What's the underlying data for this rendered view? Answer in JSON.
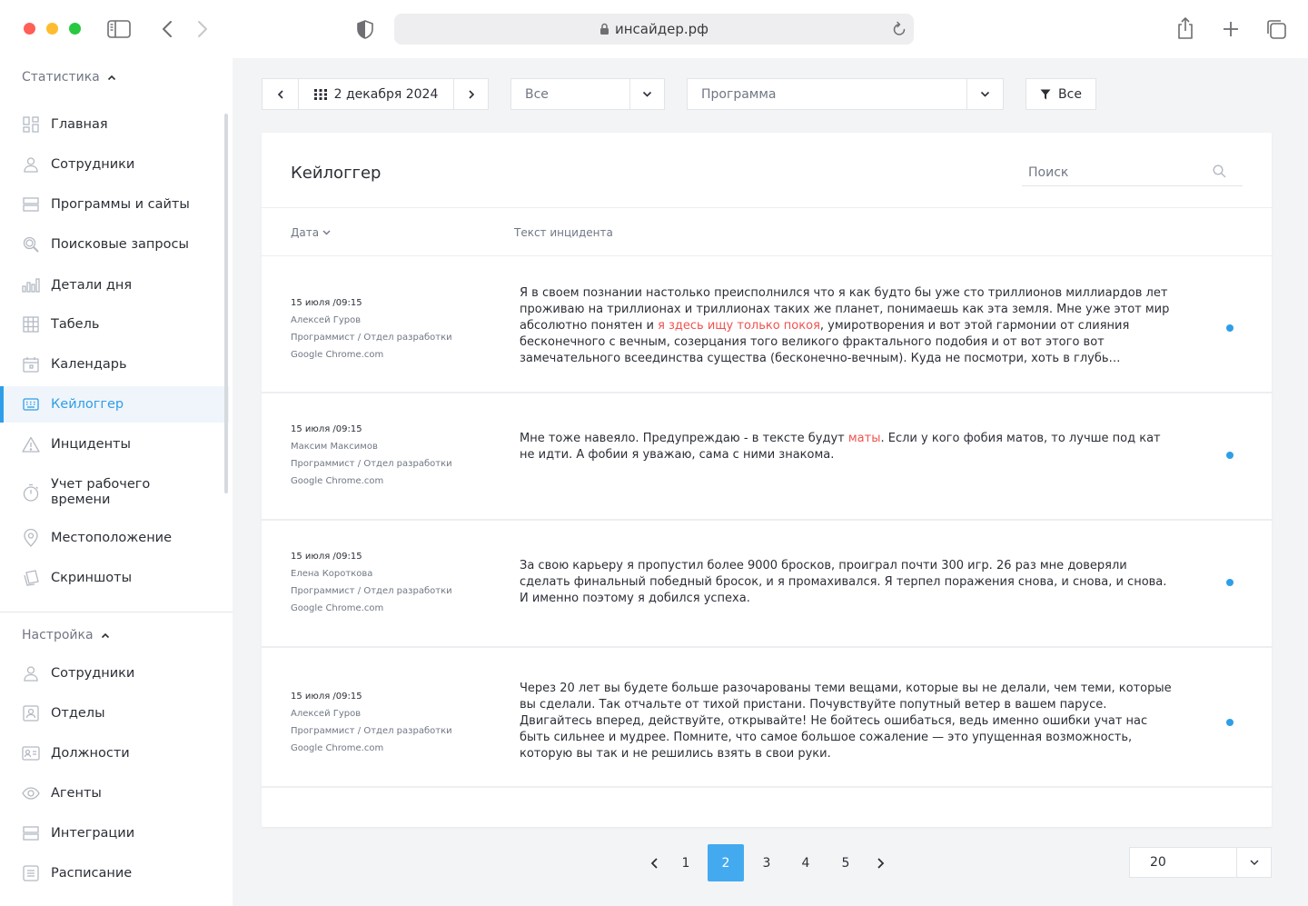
{
  "browser": {
    "url": "инсайдер.рф",
    "traffic_lights": [
      "#ff5f57",
      "#febc2e",
      "#28c840"
    ]
  },
  "sidebar": {
    "stats_section": "Статистика",
    "stats_items": [
      {
        "label": "Главная",
        "icon": "dashboard-icon"
      },
      {
        "label": "Сотрудники",
        "icon": "user-icon"
      },
      {
        "label": "Программы и сайты",
        "icon": "server-icon"
      },
      {
        "label": "Поисковые запросы",
        "icon": "search-icon"
      },
      {
        "label": "Детали дня",
        "icon": "bar-chart-icon"
      },
      {
        "label": "Табель",
        "icon": "grid-table-icon"
      },
      {
        "label": "Календарь",
        "icon": "calendar-icon"
      },
      {
        "label": "Кейлоггер",
        "icon": "keyboard-icon",
        "active": true
      },
      {
        "label": "Инциденты",
        "icon": "warning-icon"
      },
      {
        "label": "Учет рабочего\nвремени",
        "icon": "stopwatch-icon"
      },
      {
        "label": "Местоположение",
        "icon": "location-pin-icon"
      },
      {
        "label": "Скриншоты",
        "icon": "screenshots-icon"
      }
    ],
    "settings_section": "Настройка",
    "settings_items": [
      {
        "label": "Сотрудники",
        "icon": "user-icon"
      },
      {
        "label": "Отделы",
        "icon": "departments-icon"
      },
      {
        "label": "Должности",
        "icon": "id-card-icon"
      },
      {
        "label": "Агенты",
        "icon": "eye-icon"
      },
      {
        "label": "Интеграции",
        "icon": "server-icon"
      },
      {
        "label": "Расписание",
        "icon": "list-icon"
      }
    ]
  },
  "filters": {
    "date": "2 декабря 2024",
    "scope": "Все",
    "program_placeholder": "Программа",
    "filter_label": "Все"
  },
  "card": {
    "title": "Кейлоггер",
    "search_placeholder": "Поиск",
    "col_date": "Дата",
    "col_text": "Текст инцидента"
  },
  "rows": [
    {
      "date": "15 июля /09:15",
      "name": "Алексей Гуров",
      "role": "Программист / Отдел разработки",
      "app": "Google Chrome.com",
      "text_before": "Я в своем познании настолько преисполнился что я как будто бы уже сто триллионов миллиардов лет проживаю на триллионах и триллионах таких же планет, понимаешь как эта земля. Мне уже этот мир абсолютно понятен и ",
      "highlight": "я здесь ищу только покоя",
      "text_after": ", умиротворения и вот этой гармонии от слияния бесконечного с вечным, созерцания того великого фрактального подобия и от вот этого вот замечательного всеединства существа (бесконечно-вечным). Куда не посмотри, хоть в глубь…"
    },
    {
      "date": "15 июля /09:15",
      "name": "Максим Максимов",
      "role": "Программист / Отдел разработки",
      "app": "Google Chrome.com",
      "text_before": "Мне тоже навеяло. Предупреждаю - в тексте будут ",
      "highlight": "маты",
      "text_after": ". Если у кого фобия матов, то лучше под кат не идти. А фобии я уважаю, сама с ними знакома."
    },
    {
      "date": "15 июля /09:15",
      "name": "Елена Короткова",
      "role": "Программист / Отдел разработки",
      "app": "Google Chrome.com",
      "text_before": "За свою карьеру я пропустил более 9000 бросков, проиграл почти 300 игр. 26 раз мне доверяли сделать финальный победный бросок, и я промахивался. Я терпел поражения снова, и снова, и снова. И именно поэтому я добился успеха.",
      "highlight": "",
      "text_after": ""
    },
    {
      "date": "15 июля /09:15",
      "name": "Алексей Гуров",
      "role": "Программист / Отдел разработки",
      "app": "Google Chrome.com",
      "text_before": "Через 20 лет вы будете больше разочарованы теми вещами, которые вы не делали, чем теми, которые вы сделали. Так отчальте от тихой пристани. Почувствуйте попутный ветер в вашем парусе. Двигайтесь вперед, действуйте, открывайте! Не бойтесь ошибаться, ведь именно ошибки учат нас быть сильнее и мудрее. Помните, что самое большое сожаление — это упущенная возможность, которую вы так и не решились взять в свои руки.",
      "highlight": "",
      "text_after": ""
    }
  ],
  "pagination": {
    "pages": [
      "1",
      "2",
      "3",
      "4",
      "5"
    ],
    "current": "2",
    "per_page": "20"
  },
  "colors": {
    "accent": "#2f9ee8",
    "highlight": "#ef5350",
    "active_page": "#44aaf0"
  }
}
